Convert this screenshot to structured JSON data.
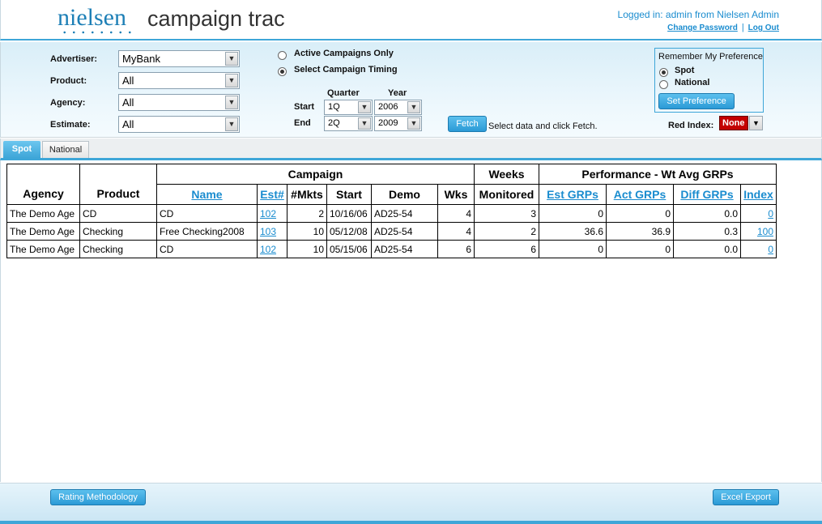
{
  "header": {
    "brand": "nielsen",
    "app_title": "campaign trac",
    "login_info": "Logged in: admin from Nielsen Admin",
    "change_password": "Change Password",
    "separator": "|",
    "log_out": "Log Out"
  },
  "filters": {
    "advertiser": {
      "label": "Advertiser:",
      "value": "MyBank"
    },
    "product": {
      "label": "Product:",
      "value": "All"
    },
    "agency": {
      "label": "Agency:",
      "value": "All"
    },
    "estimate": {
      "label": "Estimate:",
      "value": "All"
    },
    "active_only": {
      "label": "Active Campaigns Only",
      "selected": false
    },
    "select_timing": {
      "label": "Select Campaign Timing",
      "selected": true
    },
    "quarter_label": "Quarter",
    "year_label": "Year",
    "start_label": "Start",
    "end_label": "End",
    "start_quarter": "1Q",
    "start_year": "2006",
    "end_quarter": "2Q",
    "end_year": "2009",
    "fetch_label": "Fetch",
    "fetch_hint": "Select data and click Fetch."
  },
  "preference": {
    "title": "Remember My Preference",
    "spot": "Spot",
    "national": "National",
    "selected": "Spot",
    "set_label": "Set Preference"
  },
  "red_index": {
    "label": "Red Index:",
    "value": "None"
  },
  "tabs": [
    {
      "label": "Spot",
      "active": true
    },
    {
      "label": "National",
      "active": false
    }
  ],
  "table": {
    "group_campaign": "Campaign",
    "group_weeks_top": "Weeks",
    "group_weeks_bottom": "Monitored",
    "group_performance": "Performance - Wt Avg GRPs",
    "col_agency": "Agency",
    "col_product": "Product",
    "col_name": "Name",
    "col_est": "Est#",
    "col_mkts": "#Mkts",
    "col_start": "Start",
    "col_demo": "Demo",
    "col_wks": "Wks",
    "col_est_grps": "Est GRPs",
    "col_act_grps": "Act GRPs",
    "col_diff_grps": "Diff GRPs",
    "col_index": "Index",
    "rows": [
      {
        "agency": "The Demo Age",
        "product": "CD",
        "name": "CD",
        "est": "102",
        "mkts": "2",
        "start": "10/16/06",
        "demo": "AD25-54",
        "wks": "4",
        "weeks_monitored": "3",
        "est_grps": "0",
        "act_grps": "0",
        "diff_grps": "0.0",
        "index": "0"
      },
      {
        "agency": "The Demo Age",
        "product": "Checking",
        "name": "Free Checking2008",
        "est": "103",
        "mkts": "10",
        "start": "05/12/08",
        "demo": "AD25-54",
        "wks": "4",
        "weeks_monitored": "2",
        "est_grps": "36.6",
        "act_grps": "36.9",
        "diff_grps": "0.3",
        "index": "100"
      },
      {
        "agency": "The Demo Age",
        "product": "Checking",
        "name": "CD",
        "est": "102",
        "mkts": "10",
        "start": "05/15/06",
        "demo": "AD25-54",
        "wks": "6",
        "weeks_monitored": "6",
        "est_grps": "0",
        "act_grps": "0",
        "diff_grps": "0.0",
        "index": "0"
      }
    ]
  },
  "footer": {
    "rating_methodology": "Rating Methodology",
    "excel_export": "Excel Export"
  },
  "colors": {
    "accent": "#3ea6d8",
    "link": "#1a8ccf",
    "red_index": "#c40000"
  }
}
